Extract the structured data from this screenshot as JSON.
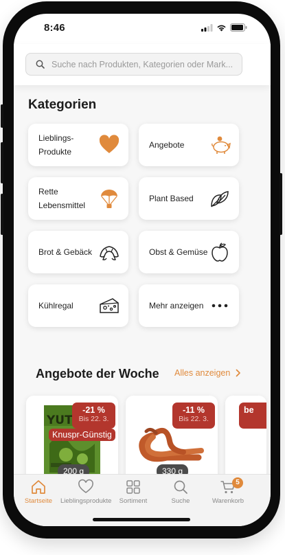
{
  "status_bar": {
    "time": "8:46"
  },
  "search": {
    "placeholder": "Suche nach Produkten, Kategorien oder Mark..."
  },
  "categories": {
    "title": "Kategorien",
    "items": [
      {
        "label": "Lieblings-Produkte",
        "icon": "heart-icon"
      },
      {
        "label": "Angebote",
        "icon": "piggy-bank-icon"
      },
      {
        "label": "Rette Lebensmittel",
        "icon": "parachute-icon"
      },
      {
        "label": "Plant Based",
        "icon": "leaves-icon"
      },
      {
        "label": "Brot & Gebäck",
        "icon": "croissant-icon"
      },
      {
        "label": "Obst & Gemüse",
        "icon": "apple-icon"
      },
      {
        "label": "Kühlregal",
        "icon": "cheese-icon"
      },
      {
        "label": "Mehr anzeigen",
        "icon": "more-dots-icon"
      }
    ]
  },
  "offers": {
    "title": "Angebote der Woche",
    "link_label": "Alles anzeigen",
    "products": [
      {
        "discount": "-21 %",
        "until": "Bis 22. 3.",
        "tag": "Knuspr-Günstig",
        "weight": "200 g",
        "brand_text": "YUT"
      },
      {
        "discount": "-11 %",
        "until": "Bis 22. 3.",
        "weight": "330 g"
      },
      {
        "discount": "be"
      }
    ]
  },
  "tabbar": {
    "items": [
      {
        "label": "Startseite",
        "icon": "home-icon",
        "active": true
      },
      {
        "label": "Lieblingsprodukte",
        "icon": "heart-outline-icon"
      },
      {
        "label": "Sortiment",
        "icon": "grid-icon"
      },
      {
        "label": "Suche",
        "icon": "search-icon"
      },
      {
        "label": "Warenkorb",
        "icon": "cart-icon",
        "badge": "5"
      }
    ]
  },
  "colors": {
    "accent": "#e08a3c",
    "discount": "#b3362d",
    "background": "#f7f7f7"
  }
}
